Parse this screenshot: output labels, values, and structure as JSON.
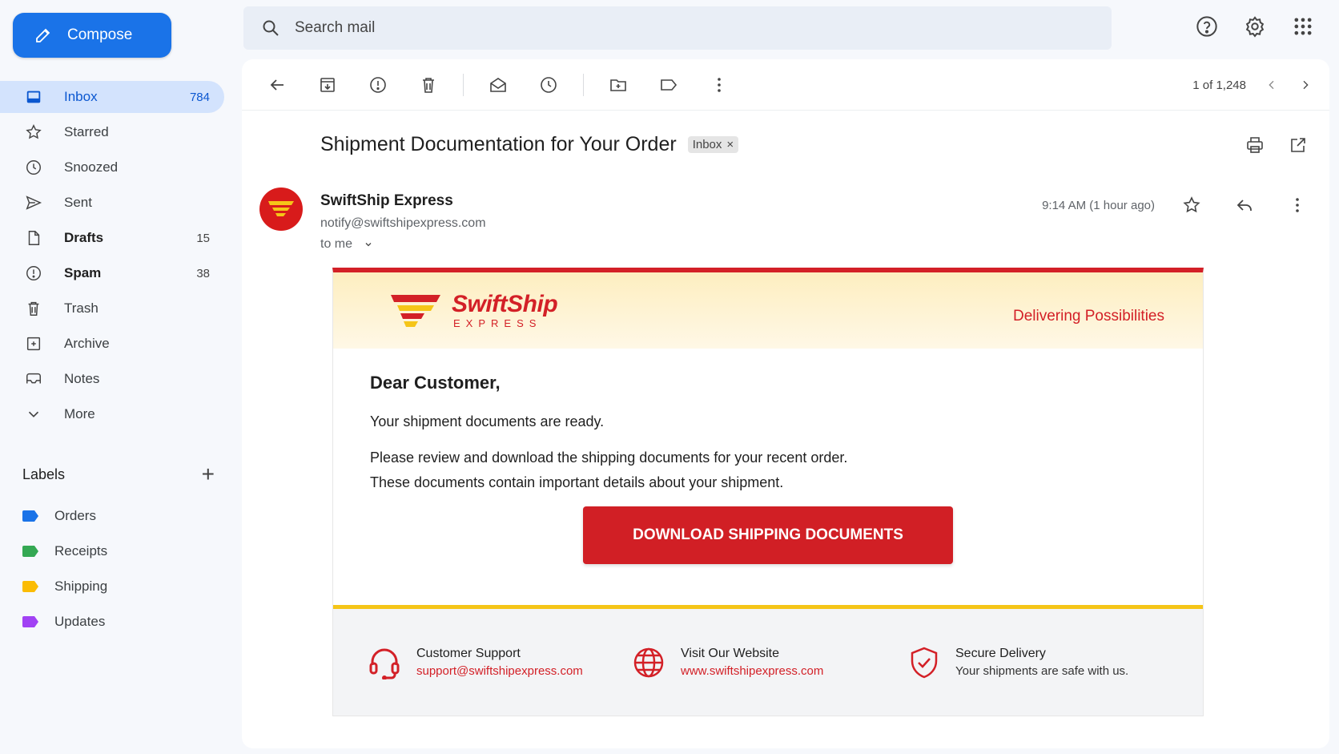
{
  "compose_label": "Compose",
  "nav": [
    {
      "label": "Inbox",
      "count": "784",
      "icon": "inbox-icon"
    },
    {
      "label": "Starred",
      "count": "",
      "icon": "star-icon"
    },
    {
      "label": "Snoozed",
      "count": "",
      "icon": "clock-icon"
    },
    {
      "label": "Sent",
      "count": "",
      "icon": "send-icon"
    },
    {
      "label": "Drafts",
      "count": "15",
      "icon": "draft-icon"
    },
    {
      "label": "Spam",
      "count": "38",
      "icon": "spam-icon"
    },
    {
      "label": "Trash",
      "count": "",
      "icon": "trash-icon"
    },
    {
      "label": "Archive",
      "count": "",
      "icon": "archive-icon"
    },
    {
      "label": "Notes",
      "count": "",
      "icon": "notes-icon"
    },
    {
      "label": "More",
      "count": "",
      "icon": "chevron-down-icon"
    }
  ],
  "labels_heading": "Labels",
  "labels": [
    {
      "label": "Orders",
      "color": "#1a73e8"
    },
    {
      "label": "Receipts",
      "color": "#34a853"
    },
    {
      "label": "Shipping",
      "color": "#fbbc04"
    },
    {
      "label": "Updates",
      "color": "#a142f4"
    }
  ],
  "search_placeholder": "Search mail",
  "pager": "1 of 1,248",
  "subject": "Shipment Documentation for Your Order",
  "subject_chip": "Inbox",
  "sender": {
    "name": "SwiftShip Express",
    "email": "notify@swiftshipexpress.com",
    "to": "to me",
    "time": "9:14 AM (1 hour ago)"
  },
  "email": {
    "brand_name": "SwiftShip",
    "brand_sub": "EXPRESS",
    "tagline": "Delivering Possibilities",
    "greeting": "Dear Customer,",
    "line1": "Your shipment documents are ready.",
    "line2": "Please review and download the shipping documents for your recent order.",
    "line3": "These documents contain important details about your shipment.",
    "cta": "DOWNLOAD SHIPPING DOCUMENTS",
    "footer": {
      "support_title": "Customer Support",
      "support_email": "support@swiftshipexpress.com",
      "website_title": "Visit Our Website",
      "website_url": "www.swiftshipexpress.com",
      "secure_title": "Secure Delivery",
      "secure_text": "Your shipments are safe with us."
    }
  },
  "colors": {
    "accent": "#1a73e8",
    "brand_red": "#d32027",
    "brand_yellow": "#f5c518"
  }
}
